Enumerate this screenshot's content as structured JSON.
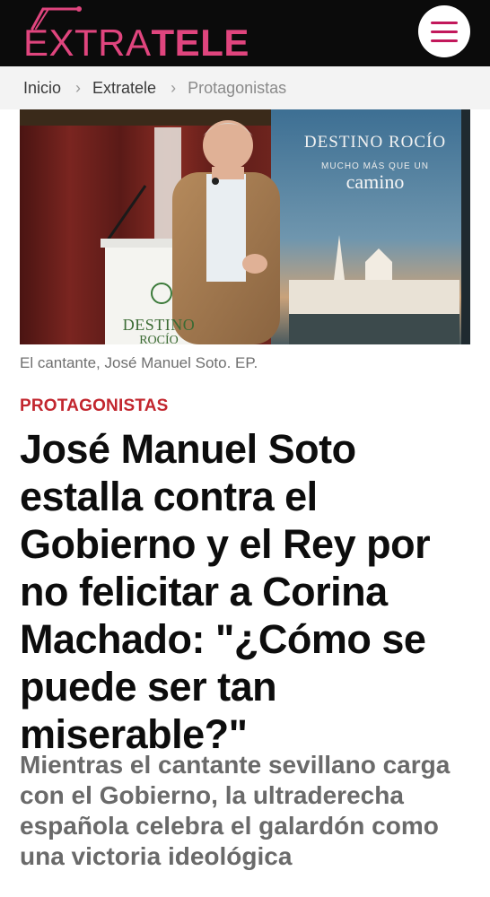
{
  "header": {
    "logo_light": "EXTRA",
    "logo_bold": "TELE",
    "brand_color": "#e0457e",
    "menu_icon": "hamburger-menu-icon"
  },
  "breadcrumb": {
    "items": [
      "Inicio",
      "Extratele",
      "Protagonistas"
    ],
    "separator": "›"
  },
  "photo": {
    "banner_title": "DESTINO ROCÍO",
    "banner_tagline_1": "MUCHO MÁS QUE UN",
    "banner_tagline_2": "camino",
    "podium_text": "DESTINO",
    "podium_text_2": "ROCÍO"
  },
  "caption": "El cantante, José Manuel Soto. EP.",
  "article": {
    "section": "PROTAGONISTAS",
    "section_color": "#c2262e",
    "headline_lines": [
      "José Manuel Soto",
      "estalla contra el",
      "Gobierno y el Rey por",
      "no felicitar a Corina",
      "Machado: \"¿Cómo se",
      "puede ser tan",
      "miserable?\""
    ],
    "subheadline_lines": [
      "Mientras el cantante sevillano carga",
      "con el Gobierno, la ultraderecha",
      "española celebra el galardón como",
      "una victoria ideológica"
    ]
  }
}
